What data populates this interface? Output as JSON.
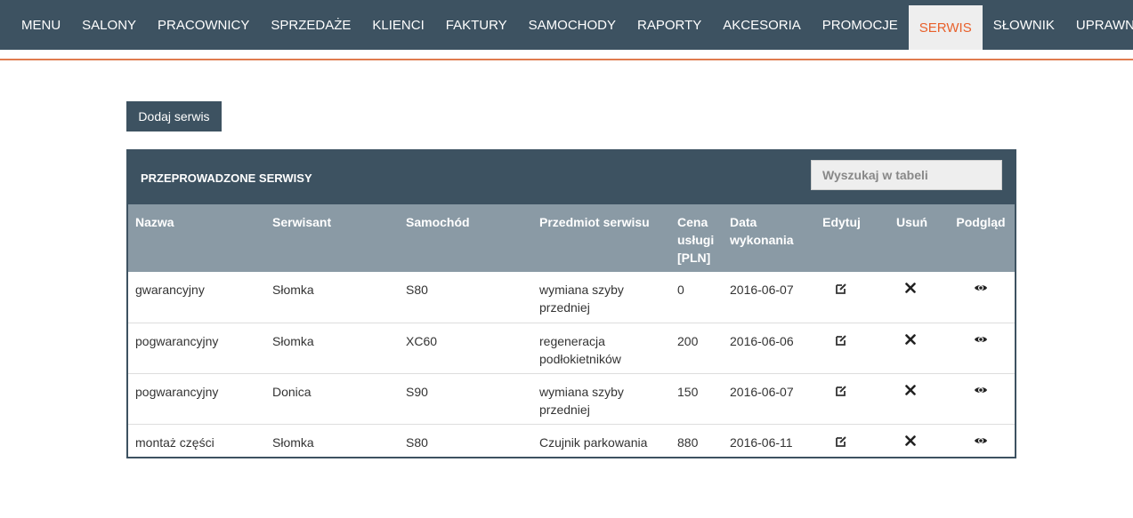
{
  "nav": {
    "items": [
      {
        "label": "MENU"
      },
      {
        "label": "SALONY"
      },
      {
        "label": "PRACOWNICY"
      },
      {
        "label": "SPRZEDAŻE"
      },
      {
        "label": "KLIENCI"
      },
      {
        "label": "FAKTURY"
      },
      {
        "label": "SAMOCHODY"
      },
      {
        "label": "RAPORTY"
      },
      {
        "label": "AKCESORIA"
      },
      {
        "label": "PROMOCJE"
      },
      {
        "label": "SERWIS"
      },
      {
        "label": "SŁOWNIK"
      },
      {
        "label": "UPRAWNIENIA"
      }
    ],
    "active": "SERWIS"
  },
  "toolbar": {
    "add_label": "Dodaj serwis"
  },
  "panel": {
    "title": "PRZEPROWADZONE SERWISY",
    "search_placeholder": "Wyszukaj w tabeli"
  },
  "table": {
    "columns": [
      "Nazwa",
      "Serwisant",
      "Samochód",
      "Przedmiot serwisu",
      "Cena usługi [PLN]",
      "Data wykonania",
      "Edytuj",
      "Usuń",
      "Podgląd"
    ],
    "rows": [
      {
        "nazwa": "gwarancyjny",
        "serwisant": "Słomka",
        "samochod": "S80",
        "przedmiot": "wymiana szyby przedniej",
        "cena": "0",
        "data": "2016-06-07"
      },
      {
        "nazwa": "pogwarancyjny",
        "serwisant": "Słomka",
        "samochod": "XC60",
        "przedmiot": "regeneracja podłokietników",
        "cena": "200",
        "data": "2016-06-06"
      },
      {
        "nazwa": "pogwarancyjny",
        "serwisant": "Donica",
        "samochod": "S90",
        "przedmiot": "wymiana szyby przedniej",
        "cena": "150",
        "data": "2016-06-07"
      },
      {
        "nazwa": "montaż części",
        "serwisant": "Słomka",
        "samochod": "S80",
        "przedmiot": "Czujnik parkowania",
        "cena": "880",
        "data": "2016-06-11"
      }
    ]
  },
  "icons": {
    "edit": "edit-icon",
    "delete": "close-icon",
    "view": "eye-icon"
  },
  "colors": {
    "navbar": "#3d5261",
    "active_text": "#e8612c",
    "table_header": "#8a9aa5"
  }
}
